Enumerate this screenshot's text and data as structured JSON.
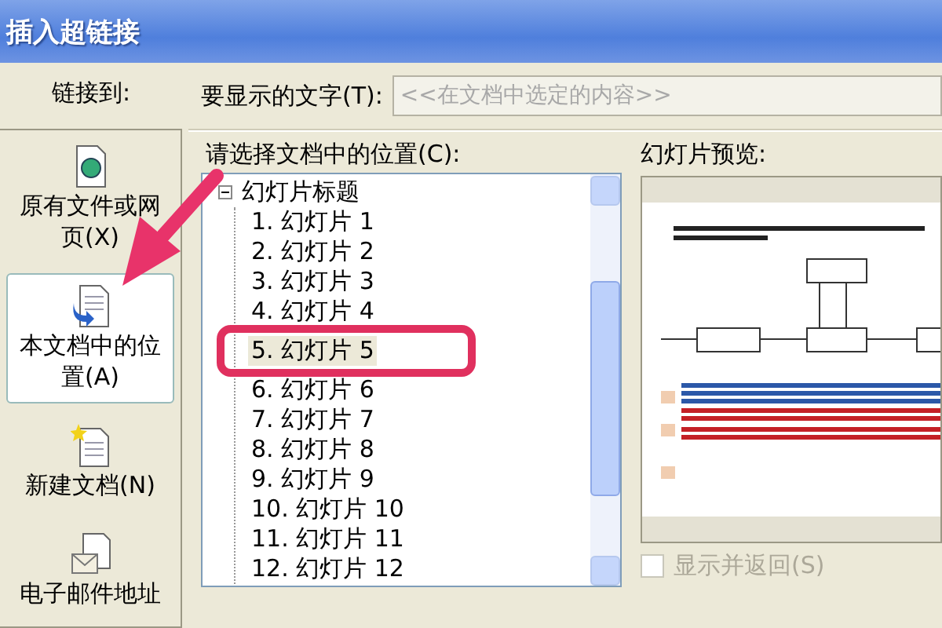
{
  "window": {
    "title": "插入超链接"
  },
  "link_to": {
    "label": "链接到:",
    "items": [
      {
        "label": "原有文件或网页(X)",
        "kind": "file",
        "selected": false
      },
      {
        "label": "本文档中的位置(A)",
        "kind": "place",
        "selected": true
      },
      {
        "label": "新建文档(N)",
        "kind": "new",
        "selected": false
      },
      {
        "label": "电子邮件地址",
        "kind": "email",
        "selected": false
      }
    ]
  },
  "display_text": {
    "label": "要显示的文字(T):",
    "placeholder": "<<在文档中选定的内容>>",
    "disabled": true
  },
  "location": {
    "label": "请选择文档中的位置(C):",
    "tree": [
      {
        "label": "幻灯片标题",
        "expanded": true,
        "children": [
          {
            "label": "1. 幻灯片 1",
            "selected": false
          },
          {
            "label": "2. 幻灯片 2",
            "selected": false
          },
          {
            "label": "3. 幻灯片 3",
            "selected": false
          },
          {
            "label": "4. 幻灯片 4",
            "selected": false
          },
          {
            "label": "5. 幻灯片 5",
            "selected": true
          },
          {
            "label": "6. 幻灯片 6",
            "selected": false
          },
          {
            "label": "7. 幻灯片 7",
            "selected": false
          },
          {
            "label": "8. 幻灯片 8",
            "selected": false
          },
          {
            "label": "9. 幻灯片 9",
            "selected": false
          },
          {
            "label": "10. 幻灯片 10",
            "selected": false
          },
          {
            "label": "11. 幻灯片 11",
            "selected": false
          },
          {
            "label": "12. 幻灯片 12",
            "selected": false
          }
        ]
      }
    ]
  },
  "preview": {
    "label": "幻灯片预览:"
  },
  "show_and_return": {
    "label": "显示并返回(S)",
    "checked": false,
    "disabled": true
  }
}
